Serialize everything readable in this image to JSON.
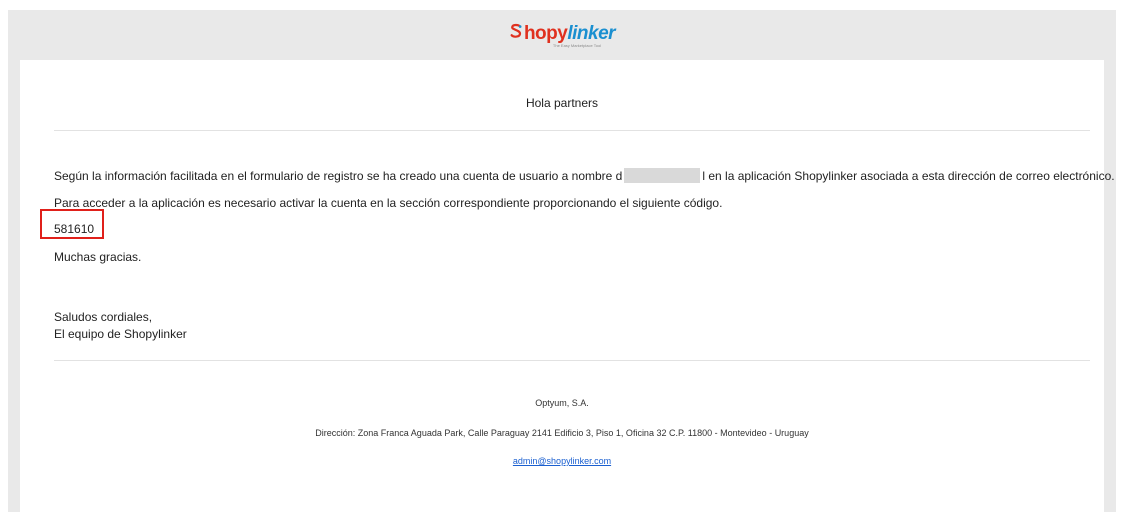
{
  "header": {
    "logo_name": "Shopylinker",
    "logo_part1": "hopy",
    "logo_part2": "linker",
    "logo_tagline": "The Easy Marketplace Tool",
    "logo_icon": "shopylinker-s-logo-icon"
  },
  "email": {
    "greeting": "Hola partners",
    "paragraph1_before": "Según la información facilitada en el formulario de registro se ha creado una cuenta de usuario a nombre d",
    "paragraph1_after": "l en la aplicación Shopylinker asociada a esta dirección de correo electrónico.",
    "paragraph2": "Para acceder a la aplicación es necesario activar la cuenta en la sección correspondiente proporcionando el siguiente código.",
    "code": "581610",
    "thanks": "Muchas gracias.",
    "signoff1": "Saludos cordiales,",
    "signoff2": "El equipo de Shopylinker"
  },
  "footer": {
    "company": "Optyum, S.A.",
    "address": "Dirección: Zona Franca Aguada Park, Calle Paraguay 2141 Edificio 3, Piso 1, Oficina 32 C.P. 11800 - Montevideo - Uruguay",
    "email_link": "admin@shopylinker.com"
  },
  "colors": {
    "frame_bg": "#e9e9e9",
    "highlight_border": "#e0201a",
    "link": "#1a5fd0",
    "logo_red": "#e0311f",
    "logo_blue": "#1a8fd0"
  }
}
